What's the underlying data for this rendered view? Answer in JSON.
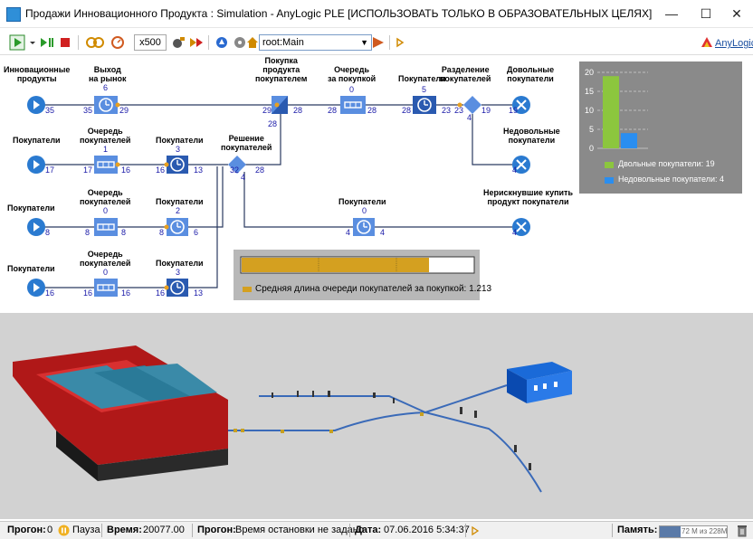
{
  "window": {
    "title": "Продажи Инновационного Продукта : Simulation - AnyLogic PLE [ИСПОЛЬЗОВАТЬ ТОЛЬКО В ОБРАЗОВАТЕЛЬНЫХ ЦЕЛЯХ]",
    "minimize": "—",
    "maximize": "☐",
    "close": "✕"
  },
  "toolbar": {
    "speed": "x500",
    "root_select": "root:Main",
    "brand": "AnyLogic"
  },
  "model": {
    "labels": {
      "innov_products": "Инновационные\nпродукты",
      "exit_market": "Выход\nна рынок",
      "purchase": "Покупка\nпродукта\nпокупателем",
      "queue_purchase": "Очередь\nза покупкой",
      "buyers_top": "Покупатели",
      "split": "Разделение\nпокупателей",
      "satisfied": "Довольные\nпокупатели",
      "unsatisfied": "Недовольные\nпокупатели",
      "buyers_r2": "Покупатели",
      "queue_r2": "Очередь\nпокупателей",
      "buyers_r2b": "Покупатели",
      "decision": "Решение\nпокупателей",
      "buyers_r3": "Покупатели",
      "queue_r3": "Очередь\nпокупателей",
      "buyers_r3b": "Покупатели",
      "buyers_mid": "Покупатели",
      "no_risk": "Нерискнувшие купить\nпродукт покупатели",
      "buyers_r4": "Покупатели",
      "queue_r4": "Очередь\nпокупателей",
      "buyers_r4b": "Покупатели"
    },
    "counts": {
      "exit_market": "6",
      "queue_purchase": "0",
      "buyers_top": "5",
      "queue_r2": "1",
      "buyers_r2b": "3",
      "queue_r3": "0",
      "buyers_r3b": "2",
      "buyers_mid": "0",
      "queue_r4": "0",
      "buyers_r4b": "3"
    },
    "ports": {
      "src1_out": "35",
      "exit_in": "35",
      "exit_out": "29",
      "purchase_in": "29",
      "purchase_out": "28",
      "purchase_down": "28",
      "qp_in": "28",
      "qp_out": "28",
      "bt_in": "28",
      "bt_out": "23",
      "split_in": "23",
      "split_out": "19",
      "split_down": "4",
      "sat_in": "19",
      "unsat_in": "4",
      "src2_out": "17",
      "q2_in": "17",
      "q2_out": "16",
      "b2_in": "16",
      "b2_out": "13",
      "dec_in": "32",
      "dec_out": "28",
      "dec_down": "4",
      "src3_out": "8",
      "q3_in": "8",
      "q3_out": "8",
      "b3_in": "8",
      "b3_out": "6",
      "mid_in": "4",
      "mid_out": "4",
      "norisk_in": "4",
      "src4_out": "16",
      "q4_in": "16",
      "q4_out": "16",
      "b4_in": "16",
      "b4_out": "13"
    }
  },
  "bar_chart": {
    "ticks": [
      "20",
      "15",
      "10",
      "5",
      "0"
    ],
    "legend": [
      {
        "label": "Двольные покупатели: 19",
        "color": "#8cc63e"
      },
      {
        "label": "Недовольные покупатели: 4",
        "color": "#2a8ef0"
      }
    ]
  },
  "chart_data": [
    {
      "type": "bar",
      "categories": [
        "Двольные покупатели",
        "Недовольные покупатели"
      ],
      "values": [
        19,
        4
      ],
      "ylim": [
        0,
        20
      ],
      "yticks": [
        0,
        5,
        10,
        15,
        20
      ],
      "colors": [
        "#8cc63e",
        "#2a8ef0"
      ],
      "legend": "bottom"
    },
    {
      "type": "bar",
      "categories": [
        "Средняя длина очереди покупателей за покупкой"
      ],
      "values": [
        1.213
      ],
      "colors": [
        "#d4a020"
      ],
      "legend": "bottom"
    }
  ],
  "avg_queue": {
    "label": "Средняя длина очереди покупателей за покупкой: 1.213"
  },
  "status": {
    "run_label": "Прогон:",
    "run_value": "0",
    "pause": "Пауза",
    "time_label": "Время:",
    "time_value": "20077.00",
    "run2_label": "Прогон:",
    "stop_text": "Время остановки не задано",
    "date_label": "Дата:",
    "date_value": "07.06.2016 5:34:37",
    "mem_label": "Память:",
    "mem_value": "72 M из 228M"
  }
}
